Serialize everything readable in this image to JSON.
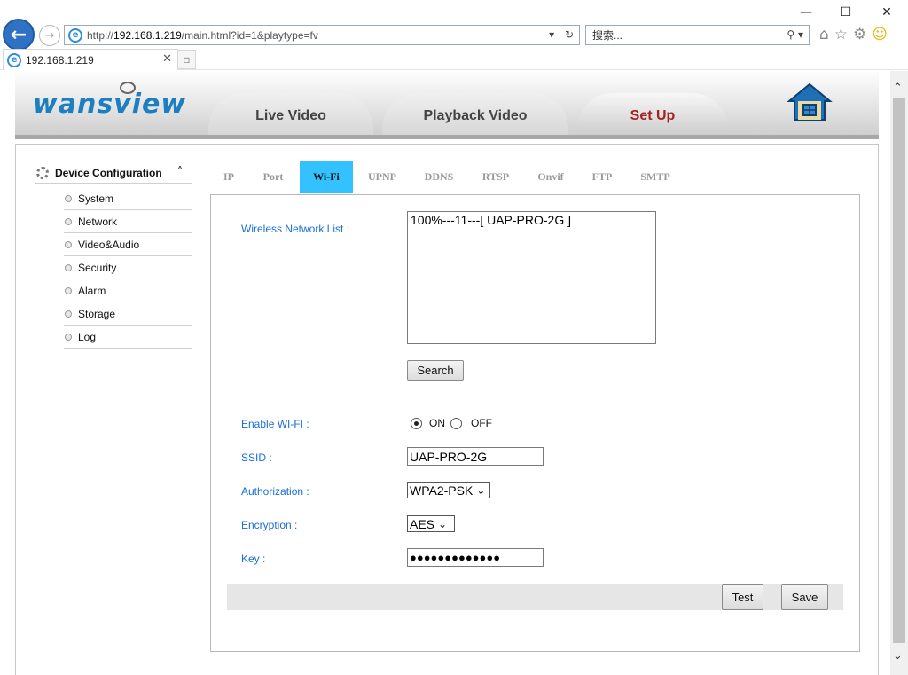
{
  "browser": {
    "address_prefix": "http://",
    "address_host": "192.168.1.219",
    "address_path": "/main.html?id=1&playtype=fv",
    "search_placeholder": "搜索...",
    "tab_title": "192.168.1.219",
    "window_controls": {
      "minimize": "—",
      "maximize": "☐",
      "close": "✕"
    }
  },
  "header": {
    "logo_text": "wansview",
    "tabs": [
      {
        "label": "Live Video"
      },
      {
        "label": "Playback Video"
      },
      {
        "label": "Set Up"
      }
    ],
    "active_tab": "Set Up"
  },
  "sidebar": {
    "title": "Device Configuration",
    "items": [
      {
        "label": "System"
      },
      {
        "label": "Network"
      },
      {
        "label": "Video&Audio"
      },
      {
        "label": "Security"
      },
      {
        "label": "Alarm"
      },
      {
        "label": "Storage"
      },
      {
        "label": "Log"
      }
    ]
  },
  "subtabs": [
    {
      "label": "IP"
    },
    {
      "label": "Port"
    },
    {
      "label": "Wi-Fi"
    },
    {
      "label": "UPNP"
    },
    {
      "label": "DDNS"
    },
    {
      "label": "RTSP"
    },
    {
      "label": "Onvif"
    },
    {
      "label": "FTP"
    },
    {
      "label": "SMTP"
    }
  ],
  "active_subtab": "Wi-Fi",
  "wifi": {
    "list_label": "Wireless Network List :",
    "networks": [
      "100%---11---[ UAP-PRO-2G ]"
    ],
    "search_button": "Search",
    "enable_label": "Enable WI-FI :",
    "on_label": "ON",
    "off_label": "OFF",
    "enabled": true,
    "ssid_label": "SSID :",
    "ssid_value": "UAP-PRO-2G",
    "auth_label": "Authorization :",
    "auth_value": "WPA2-PSK",
    "enc_label": "Encryption :",
    "enc_value": "AES",
    "key_label": "Key :",
    "key_value": "●●●●●●●●●●●●●",
    "test_button": "Test",
    "save_button": "Save"
  },
  "colors": {
    "accent_tab": "#33c2ff",
    "label_blue": "#1a6ed8",
    "active_main_tab": "#a52222",
    "logo_blue": "#1e7fc0"
  }
}
